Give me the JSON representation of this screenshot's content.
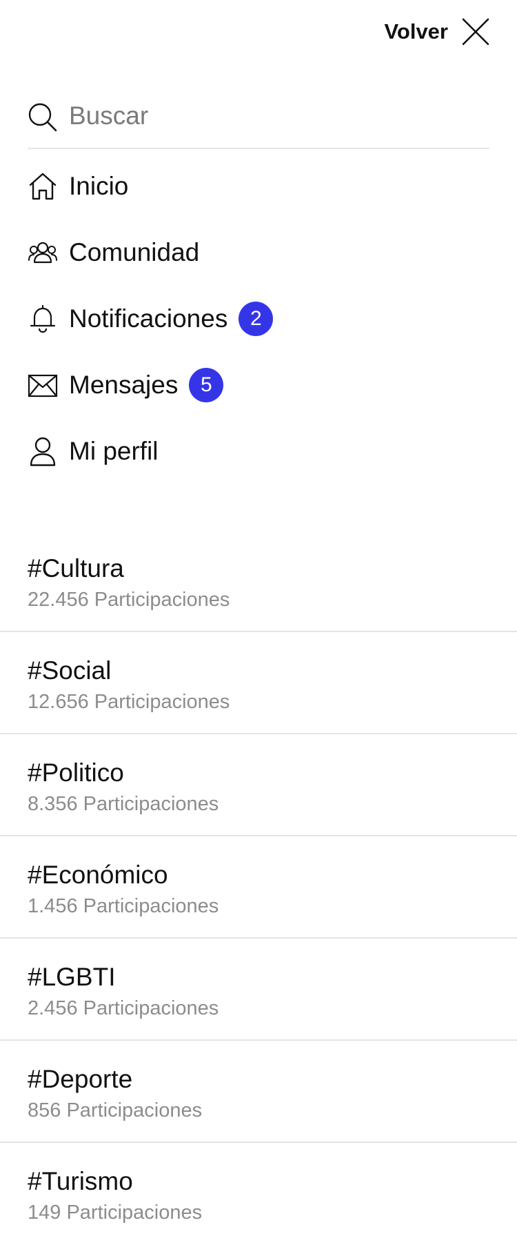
{
  "header": {
    "back_label": "Volver"
  },
  "search": {
    "placeholder": "Buscar",
    "value": ""
  },
  "nav": {
    "items": [
      {
        "label": "Inicio",
        "icon": "home-icon"
      },
      {
        "label": "Comunidad",
        "icon": "community-icon"
      },
      {
        "label": "Notificaciones",
        "icon": "bell-icon",
        "badge": "2"
      },
      {
        "label": "Mensajes",
        "icon": "mail-icon",
        "badge": "5"
      },
      {
        "label": "Mi perfil",
        "icon": "user-icon"
      }
    ]
  },
  "tags": [
    {
      "name": "#Cultura",
      "count": "22.456 Participaciones"
    },
    {
      "name": "#Social",
      "count": "12.656 Participaciones"
    },
    {
      "name": "#Politico",
      "count": "8.356 Participaciones"
    },
    {
      "name": "#Económico",
      "count": "1.456 Participaciones"
    },
    {
      "name": "#LGBTI",
      "count": "2.456 Participaciones"
    },
    {
      "name": "#Deporte",
      "count": "856 Participaciones"
    },
    {
      "name": "#Turismo",
      "count": "149 Participaciones"
    }
  ],
  "colors": {
    "badge_background": "#3535e8",
    "text_primary": "#111111",
    "text_secondary": "#8c8c8c",
    "divider": "#e4e4e4"
  }
}
